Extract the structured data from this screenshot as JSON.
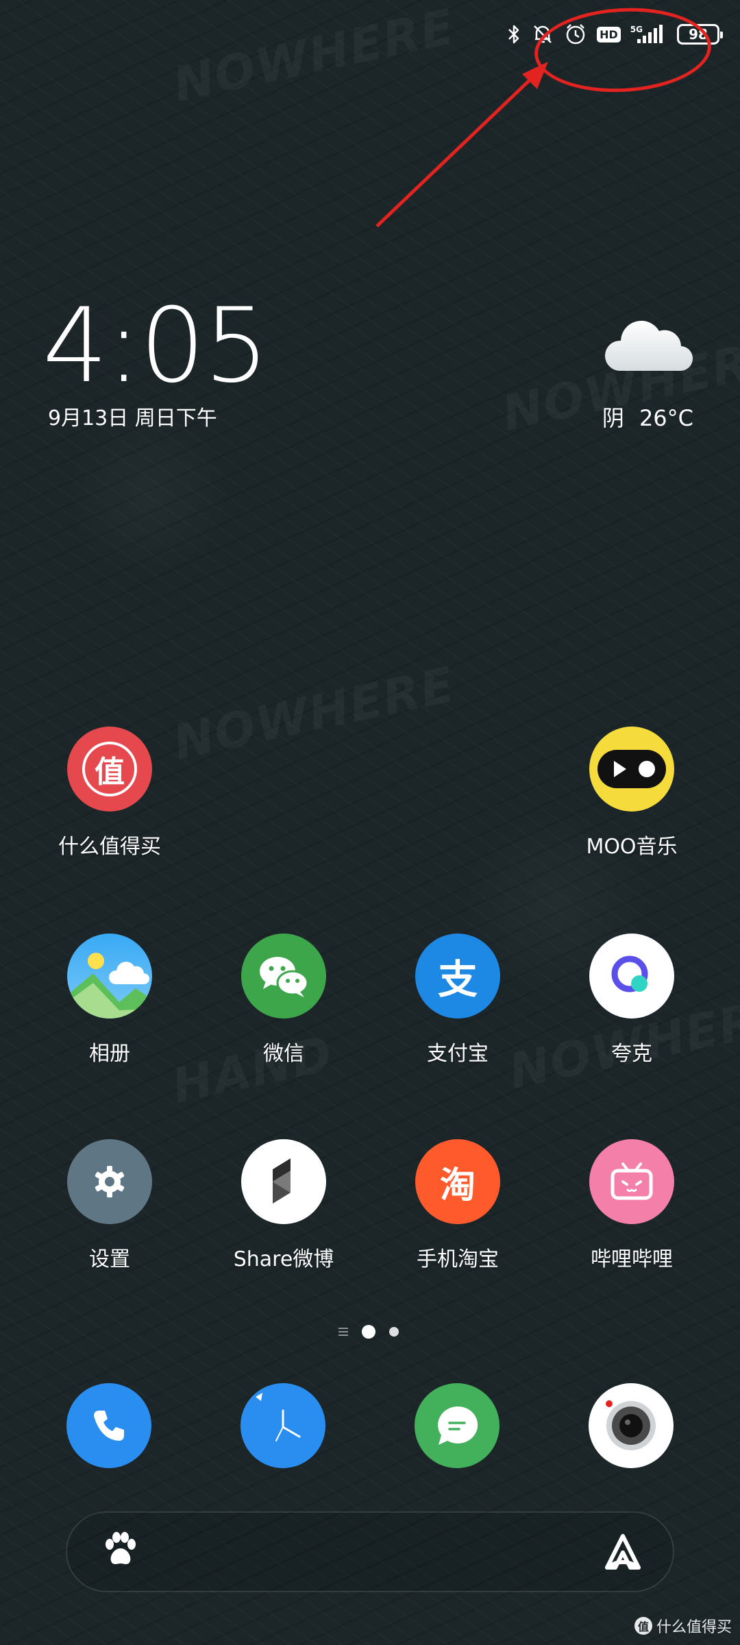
{
  "status_bar": {
    "network_type": "5G",
    "hd_badge": "HD",
    "battery_level": "98",
    "icons": [
      "bluetooth-icon",
      "mute-icon",
      "alarm-icon",
      "hd-icon",
      "signal-icon",
      "battery-icon"
    ]
  },
  "clock": {
    "time": "4:05",
    "date": "9月13日 周日下午"
  },
  "weather": {
    "condition": "阴",
    "temperature": "26°C",
    "icon": "cloud-icon"
  },
  "apps": {
    "smzdm": "什么值得买",
    "smzdm_glyph": "值",
    "moo": "MOO音乐",
    "gallery": "相册",
    "wechat": "微信",
    "alipay": "支付宝",
    "alipay_glyph": "支",
    "quark": "夸克",
    "settings": "设置",
    "share_weibo": "Share微博",
    "taobao": "手机淘宝",
    "taobao_glyph": "淘",
    "bilibili": "哔哩哔哩"
  },
  "dock": [
    "phone-icon",
    "clock-icon",
    "messages-icon",
    "camera-icon"
  ],
  "page_indicator": {
    "pages": 2,
    "current": 1
  },
  "colors": {
    "annotation": "#e3231f",
    "smzdm": "#e5484d",
    "moo": "#f5dc3c",
    "wechat": "#3da64b",
    "alipay": "#1e88e5",
    "settings": "#5f7684",
    "taobao": "#ff5a2c",
    "bilibili": "#f47fa8",
    "phone": "#2a8ef0",
    "messages": "#43b05c"
  },
  "watermark": {
    "badge": "值",
    "text": "什么值得买"
  }
}
